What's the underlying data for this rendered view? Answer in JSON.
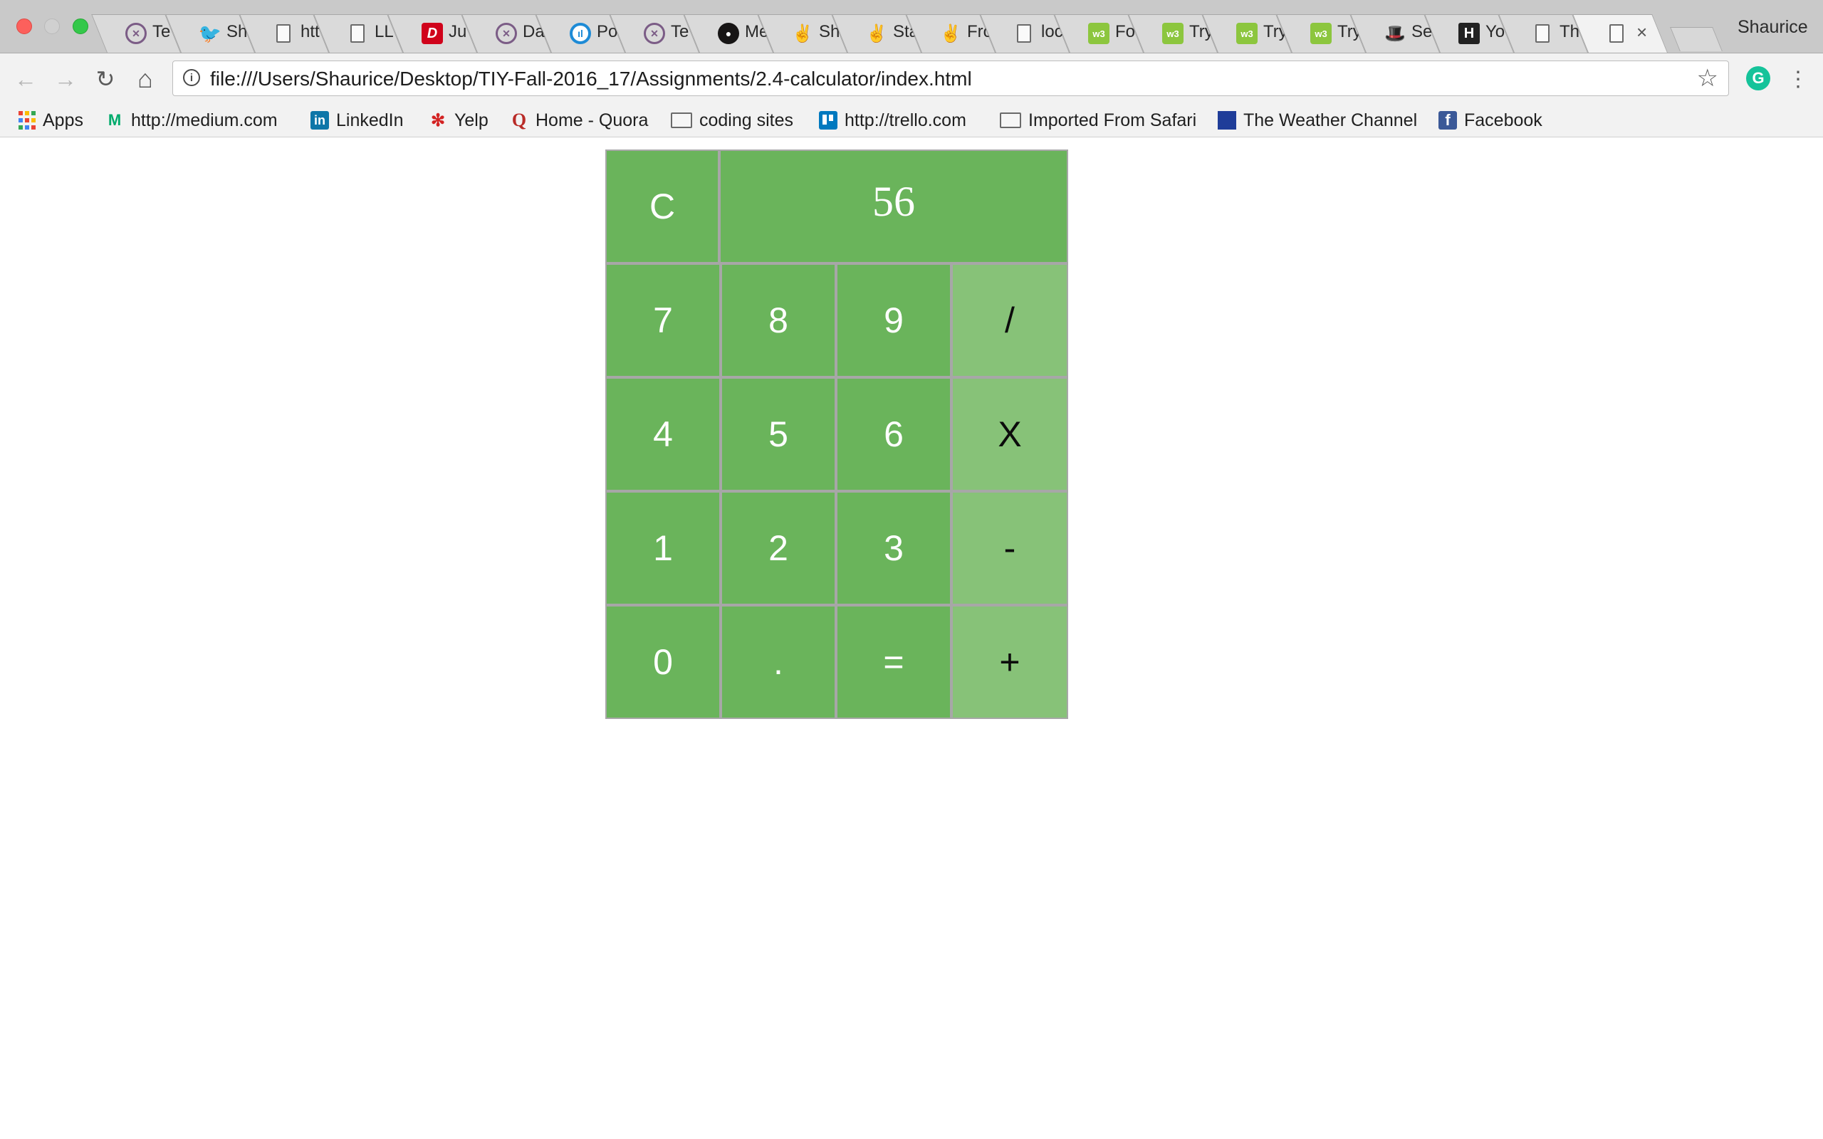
{
  "browser": {
    "tabs": [
      {
        "label": "Te",
        "icon": "petrol-pet-icon"
      },
      {
        "label": "Sh",
        "icon": "twitter-bird-icon"
      },
      {
        "label": "htt",
        "icon": "page-icon"
      },
      {
        "label": "LL",
        "icon": "page-icon"
      },
      {
        "label": "Ju",
        "icon": "red-d-icon"
      },
      {
        "label": "Da",
        "icon": "petrol-pet-icon"
      },
      {
        "label": "Po",
        "icon": "poll-circle-icon"
      },
      {
        "label": "Te",
        "icon": "petrol-pet-icon"
      },
      {
        "label": "Me",
        "icon": "github-icon"
      },
      {
        "label": "Sh",
        "icon": "peace-hand-icon"
      },
      {
        "label": "Sta",
        "icon": "peace-hand-icon"
      },
      {
        "label": "Fro",
        "icon": "peace-hand-icon"
      },
      {
        "label": "loc",
        "icon": "page-icon"
      },
      {
        "label": "Fo",
        "icon": "w3schools-icon"
      },
      {
        "label": "Try",
        "icon": "w3schools-icon"
      },
      {
        "label": "Try",
        "icon": "w3schools-icon"
      },
      {
        "label": "Try",
        "icon": "w3schools-icon"
      },
      {
        "label": "Se",
        "icon": "top-hat-icon"
      },
      {
        "label": "Yo",
        "icon": "h-letter-icon"
      },
      {
        "label": "Th",
        "icon": "page-icon"
      }
    ],
    "active_tab": {
      "icon": "page-icon",
      "close": "×"
    },
    "profile_name": "Shaurice",
    "toolbar": {
      "back": "←",
      "forward": "→",
      "reload": "↻",
      "home": "⌂",
      "info": "i",
      "url": "file:///Users/Shaurice/Desktop/TIY-Fall-2016_17/Assignments/2.4-calculator/index.html",
      "star": "☆",
      "extension": "G",
      "menu": "⋮"
    },
    "bookmarks": [
      {
        "label": "Apps",
        "icon": "apps-grid-icon"
      },
      {
        "label": "http://medium.com",
        "icon": "medium-icon"
      },
      {
        "label": "LinkedIn",
        "icon": "linkedin-icon"
      },
      {
        "label": "Yelp",
        "icon": "yelp-icon"
      },
      {
        "label": "Home - Quora",
        "icon": "quora-icon"
      },
      {
        "label": "coding sites",
        "icon": "folder-icon"
      },
      {
        "label": "http://trello.com",
        "icon": "trello-icon"
      },
      {
        "label": "Imported From Safari",
        "icon": "folder-icon"
      },
      {
        "label": "The Weather Channel",
        "icon": "weather-channel-icon"
      },
      {
        "label": "Facebook",
        "icon": "facebook-icon"
      }
    ],
    "apps_grid_colors": [
      "#ea4335",
      "#fbbc05",
      "#34a853",
      "#4285f4",
      "#ea4335",
      "#fbbc05",
      "#34a853",
      "#4285f4",
      "#ea4335"
    ]
  },
  "calculator": {
    "display": "56",
    "clear_label": "C",
    "keys": {
      "seven": "7",
      "eight": "8",
      "nine": "9",
      "divide": "/",
      "four": "4",
      "five": "5",
      "six": "6",
      "multiply": "X",
      "one": "1",
      "two": "2",
      "three": "3",
      "subtract": "-",
      "zero": "0",
      "decimal": ".",
      "equals": "=",
      "add": "+"
    },
    "colors": {
      "key_green": "#6ab45b",
      "operator_green": "#87c278",
      "border_gray": "#a7a7a7"
    }
  }
}
